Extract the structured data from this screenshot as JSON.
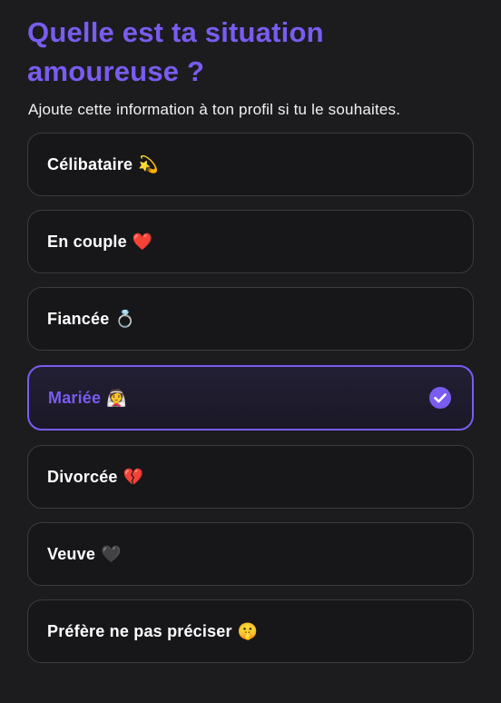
{
  "header": {
    "title": "Quelle est ta situation amoureuse ?",
    "subtitle": "Ajoute cette information à ton profil si tu le souhaites."
  },
  "options": [
    {
      "label": "Célibataire",
      "emoji": "💫",
      "icon": "dizzy-star-icon",
      "selected": false
    },
    {
      "label": "En couple",
      "emoji": "❤️",
      "icon": "red-heart-icon",
      "selected": false
    },
    {
      "label": "Fiancée",
      "emoji": "💍",
      "icon": "ring-icon",
      "selected": false
    },
    {
      "label": "Mariée",
      "emoji": "👰",
      "icon": "bride-icon",
      "selected": true
    },
    {
      "label": "Divorcée",
      "emoji": "💔",
      "icon": "broken-heart-icon",
      "selected": false
    },
    {
      "label": "Veuve",
      "emoji": "🖤",
      "icon": "black-heart-icon",
      "selected": false
    },
    {
      "label": "Préfère ne pas préciser",
      "emoji": "🤫",
      "icon": "shushing-face-icon",
      "selected": false
    }
  ],
  "colors": {
    "accent": "#7a5cf0",
    "background": "#1c1c1f",
    "card_border": "#3a3a40",
    "text": "#ffffff"
  }
}
